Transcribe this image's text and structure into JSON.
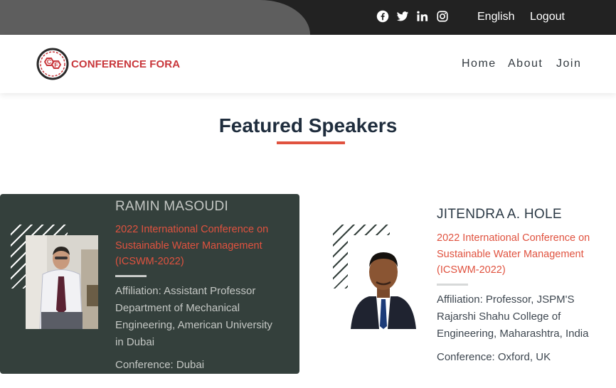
{
  "topbar": {
    "social": [
      "facebook-icon",
      "twitter-icon",
      "linkedin-icon",
      "instagram-icon"
    ],
    "language": "English",
    "logout": "Logout"
  },
  "header": {
    "logo_text": "CONFERENCE FORA",
    "logo_mark": "CF",
    "nav": [
      "Home",
      "About",
      "Join"
    ]
  },
  "section": {
    "title": "Featured Speakers"
  },
  "speakers": [
    {
      "name": "RAMIN MASOUDI",
      "conference": "2022 International Conference on Sustainable Water Management (ICSWM-2022)",
      "affiliation": "Affiliation: Assistant Professor Department of Mechanical Engineering, American University in Dubai",
      "location": "Conference: Dubai"
    },
    {
      "name": "JITENDRA A. HOLE",
      "conference": "2022 International Conference on Sustainable Water Management (ICSWM-2022)",
      "affiliation": "Affiliation: Professor, JSPM'S Rajarshi Shahu College of Engineering, Maharashtra, India",
      "location": "Conference: Oxford, UK"
    }
  ],
  "colors": {
    "accent": "#e0523f",
    "brand": "#c8363a",
    "topbar": "#222222",
    "card_dark": "#34403c"
  }
}
